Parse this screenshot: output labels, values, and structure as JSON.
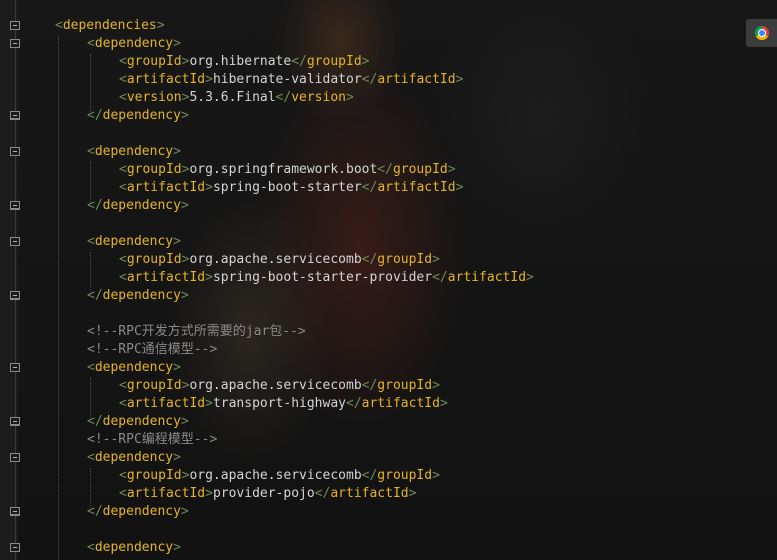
{
  "editor": {
    "lines": [
      {
        "id": "l1",
        "kind": "open",
        "tag": "dependencies"
      },
      {
        "id": "l2",
        "kind": "open",
        "tag": "dependency"
      },
      {
        "id": "l3",
        "kind": "element",
        "tag": "groupId",
        "text": "org.hibernate"
      },
      {
        "id": "l4",
        "kind": "element",
        "tag": "artifactId",
        "text": "hibernate-validator"
      },
      {
        "id": "l5",
        "kind": "element",
        "tag": "version",
        "text": "5.3.6.Final"
      },
      {
        "id": "l6",
        "kind": "close",
        "tag": "dependency"
      },
      {
        "id": "l8",
        "kind": "open",
        "tag": "dependency"
      },
      {
        "id": "l9",
        "kind": "element",
        "tag": "groupId",
        "text": "org.springframework.boot"
      },
      {
        "id": "l10",
        "kind": "element",
        "tag": "artifactId",
        "text": "spring-boot-starter"
      },
      {
        "id": "l11",
        "kind": "close",
        "tag": "dependency"
      },
      {
        "id": "l13",
        "kind": "open",
        "tag": "dependency"
      },
      {
        "id": "l14",
        "kind": "element",
        "tag": "groupId",
        "text": "org.apache.servicecomb"
      },
      {
        "id": "l15",
        "kind": "element",
        "tag": "artifactId",
        "text": "spring-boot-starter-provider"
      },
      {
        "id": "l16",
        "kind": "close",
        "tag": "dependency"
      },
      {
        "id": "l18",
        "kind": "comment",
        "text": "<!--RPC开发方式所需要的jar包-->"
      },
      {
        "id": "l19",
        "kind": "comment",
        "text": "<!--RPC通信模型-->"
      },
      {
        "id": "l20",
        "kind": "open",
        "tag": "dependency"
      },
      {
        "id": "l21",
        "kind": "element",
        "tag": "groupId",
        "text": "org.apache.servicecomb"
      },
      {
        "id": "l22",
        "kind": "element",
        "tag": "artifactId",
        "text": "transport-highway"
      },
      {
        "id": "l23",
        "kind": "close",
        "tag": "dependency"
      },
      {
        "id": "l24",
        "kind": "comment",
        "text": "<!--RPC编程模型-->"
      },
      {
        "id": "l25",
        "kind": "open",
        "tag": "dependency"
      },
      {
        "id": "l26",
        "kind": "element",
        "tag": "groupId",
        "text": "org.apache.servicecomb"
      },
      {
        "id": "l27",
        "kind": "element",
        "tag": "artifactId",
        "text": "provider-pojo"
      },
      {
        "id": "l28",
        "kind": "close",
        "tag": "dependency"
      },
      {
        "id": "l30",
        "kind": "open",
        "tag": "dependency"
      }
    ]
  },
  "browser_button": {
    "icon": "chrome-icon"
  }
}
